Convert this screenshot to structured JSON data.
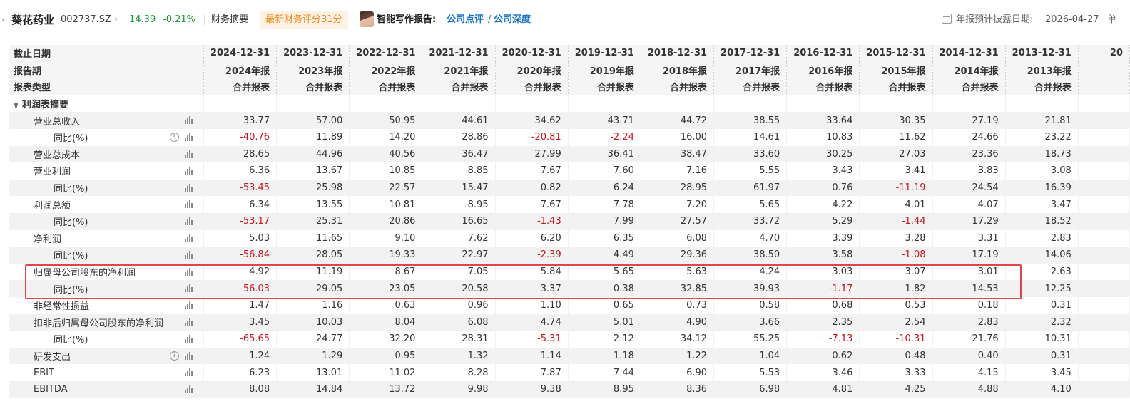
{
  "header": {
    "back_icon": "chevron-left-icon",
    "stock_name": "葵花药业",
    "stock_code": "002737.SZ",
    "forward_icon": "chevron-right-icon",
    "price": "14.39",
    "change_pct": "-0.21%",
    "fin_summary": "财务摘要",
    "score_badge": "最新财务评分31分",
    "ai_report_label": "智能写作报告:",
    "ai_link_1": "公司点评",
    "ai_slash": "/",
    "ai_link_2": "公司深度",
    "disclose_label": "年报预计披露日期:",
    "disclose_date": "2026-04-27",
    "unit_label": "单",
    "colors": {
      "up_green": "#1a9b3c",
      "negative_red": "#c8161d",
      "link_blue": "#1a73c9",
      "badge_orange": "#f08a1a",
      "highlight_border": "#e0454c"
    }
  },
  "table": {
    "header_rows": [
      {
        "label": "截止日期",
        "cells": [
          "2024-12-31",
          "2023-12-31",
          "2022-12-31",
          "2021-12-31",
          "2020-12-31",
          "2019-12-31",
          "2018-12-31",
          "2017-12-31",
          "2016-12-31",
          "2015-12-31",
          "2014-12-31",
          "2013-12-31",
          "20"
        ]
      },
      {
        "label": "报告期",
        "cells": [
          "2024年报",
          "2023年报",
          "2022年报",
          "2021年报",
          "2020年报",
          "2019年报",
          "2018年报",
          "2017年报",
          "2016年报",
          "2015年报",
          "2014年报",
          "2013年报",
          ""
        ]
      },
      {
        "label": "报表类型",
        "cells": [
          "合并报表",
          "合并报表",
          "合并报表",
          "合并报表",
          "合并报表",
          "合并报表",
          "合并报表",
          "合并报表",
          "合并报表",
          "合并报表",
          "合并报表",
          "合并报表",
          ""
        ]
      }
    ],
    "section_label": "利润表摘要",
    "rows": [
      {
        "label": "营业总收入",
        "indent": 1,
        "help": false,
        "values": [
          "33.77",
          "57.00",
          "50.95",
          "44.61",
          "34.62",
          "43.71",
          "44.72",
          "38.55",
          "33.64",
          "30.35",
          "27.19",
          "21.81"
        ]
      },
      {
        "label": "同比(%)",
        "indent": 2,
        "help": true,
        "values": [
          "-40.76",
          "11.89",
          "14.20",
          "28.86",
          "-20.81",
          "-2.24",
          "16.00",
          "14.61",
          "10.83",
          "11.62",
          "24.66",
          "23.22"
        ]
      },
      {
        "label": "营业总成本",
        "indent": 1,
        "help": false,
        "values": [
          "28.65",
          "44.96",
          "40.56",
          "36.47",
          "27.99",
          "36.41",
          "38.47",
          "33.60",
          "30.25",
          "27.03",
          "23.36",
          "18.73"
        ]
      },
      {
        "label": "营业利润",
        "indent": 1,
        "help": false,
        "values": [
          "6.36",
          "13.67",
          "10.85",
          "8.85",
          "7.67",
          "7.60",
          "7.16",
          "5.55",
          "3.43",
          "3.41",
          "3.83",
          "3.08"
        ]
      },
      {
        "label": "同比(%)",
        "indent": 2,
        "help": false,
        "values": [
          "-53.45",
          "25.98",
          "22.57",
          "15.47",
          "0.82",
          "6.24",
          "28.95",
          "61.97",
          "0.76",
          "-11.19",
          "24.54",
          "16.39"
        ]
      },
      {
        "label": "利润总额",
        "indent": 1,
        "help": false,
        "values": [
          "6.34",
          "13.55",
          "10.81",
          "8.95",
          "7.67",
          "7.78",
          "7.20",
          "5.65",
          "4.22",
          "4.01",
          "4.07",
          "3.47"
        ]
      },
      {
        "label": "同比(%)",
        "indent": 2,
        "help": false,
        "values": [
          "-53.17",
          "25.31",
          "20.86",
          "16.65",
          "-1.43",
          "7.99",
          "27.57",
          "33.72",
          "5.29",
          "-1.44",
          "17.29",
          "18.52"
        ]
      },
      {
        "label": "净利润",
        "indent": 1,
        "help": false,
        "values": [
          "5.03",
          "11.65",
          "9.10",
          "7.62",
          "6.20",
          "6.35",
          "6.08",
          "4.70",
          "3.39",
          "3.28",
          "3.31",
          "2.83"
        ]
      },
      {
        "label": "同比(%)",
        "indent": 2,
        "help": false,
        "values": [
          "-56.84",
          "28.05",
          "19.33",
          "22.97",
          "-2.39",
          "4.49",
          "29.36",
          "38.50",
          "3.58",
          "-1.08",
          "17.19",
          "14.06"
        ]
      },
      {
        "label": "归属母公司股东的净利润",
        "indent": 1,
        "help": false,
        "values": [
          "4.92",
          "11.19",
          "8.67",
          "7.05",
          "5.84",
          "5.65",
          "5.63",
          "4.24",
          "3.03",
          "3.07",
          "3.01",
          "2.63"
        ]
      },
      {
        "label": "同比(%)",
        "indent": 2,
        "help": false,
        "values": [
          "-56.03",
          "29.05",
          "23.05",
          "20.58",
          "3.37",
          "0.38",
          "32.85",
          "39.93",
          "-1.17",
          "1.82",
          "14.53",
          "12.25"
        ]
      },
      {
        "label": "非经常性损益",
        "indent": 1,
        "help": false,
        "underline": true,
        "values": [
          "1.47",
          "1.16",
          "0.63",
          "0.96",
          "1.10",
          "0.65",
          "0.73",
          "0.58",
          "0.68",
          "0.53",
          "0.18",
          "0.31"
        ]
      },
      {
        "label": "扣非后归属母公司股东的净利润",
        "indent": 1,
        "help": false,
        "values": [
          "3.45",
          "10.03",
          "8.04",
          "6.08",
          "4.74",
          "5.01",
          "4.90",
          "3.66",
          "2.35",
          "2.54",
          "2.83",
          "2.32"
        ]
      },
      {
        "label": "同比(%)",
        "indent": 2,
        "help": false,
        "values": [
          "-65.65",
          "24.77",
          "32.20",
          "28.31",
          "-5.31",
          "2.12",
          "34.12",
          "55.25",
          "-7.13",
          "-10.31",
          "21.76",
          "10.31"
        ]
      },
      {
        "label": "研发支出",
        "indent": 1,
        "help": true,
        "values": [
          "1.24",
          "1.29",
          "0.95",
          "1.32",
          "1.14",
          "1.18",
          "1.22",
          "1.04",
          "0.62",
          "0.48",
          "0.40",
          "0.31"
        ]
      },
      {
        "label": "EBIT",
        "indent": 1,
        "help": false,
        "values": [
          "6.23",
          "13.01",
          "11.02",
          "8.28",
          "7.87",
          "7.44",
          "6.90",
          "5.53",
          "3.46",
          "3.33",
          "4.15",
          "3.45"
        ]
      },
      {
        "label": "EBITDA",
        "indent": 1,
        "help": false,
        "values": [
          "8.08",
          "14.84",
          "13.72",
          "9.98",
          "9.38",
          "8.95",
          "8.36",
          "6.98",
          "4.81",
          "4.25",
          "4.88",
          "4.10"
        ]
      }
    ],
    "highlight_rows": [
      "归属母公司股东的净利润",
      "同比(%)"
    ],
    "icons": {
      "chart": "bar-chart-icon",
      "help": "help-icon",
      "section_toggle": "chevron-down-icon"
    },
    "help_glyph": "?"
  }
}
